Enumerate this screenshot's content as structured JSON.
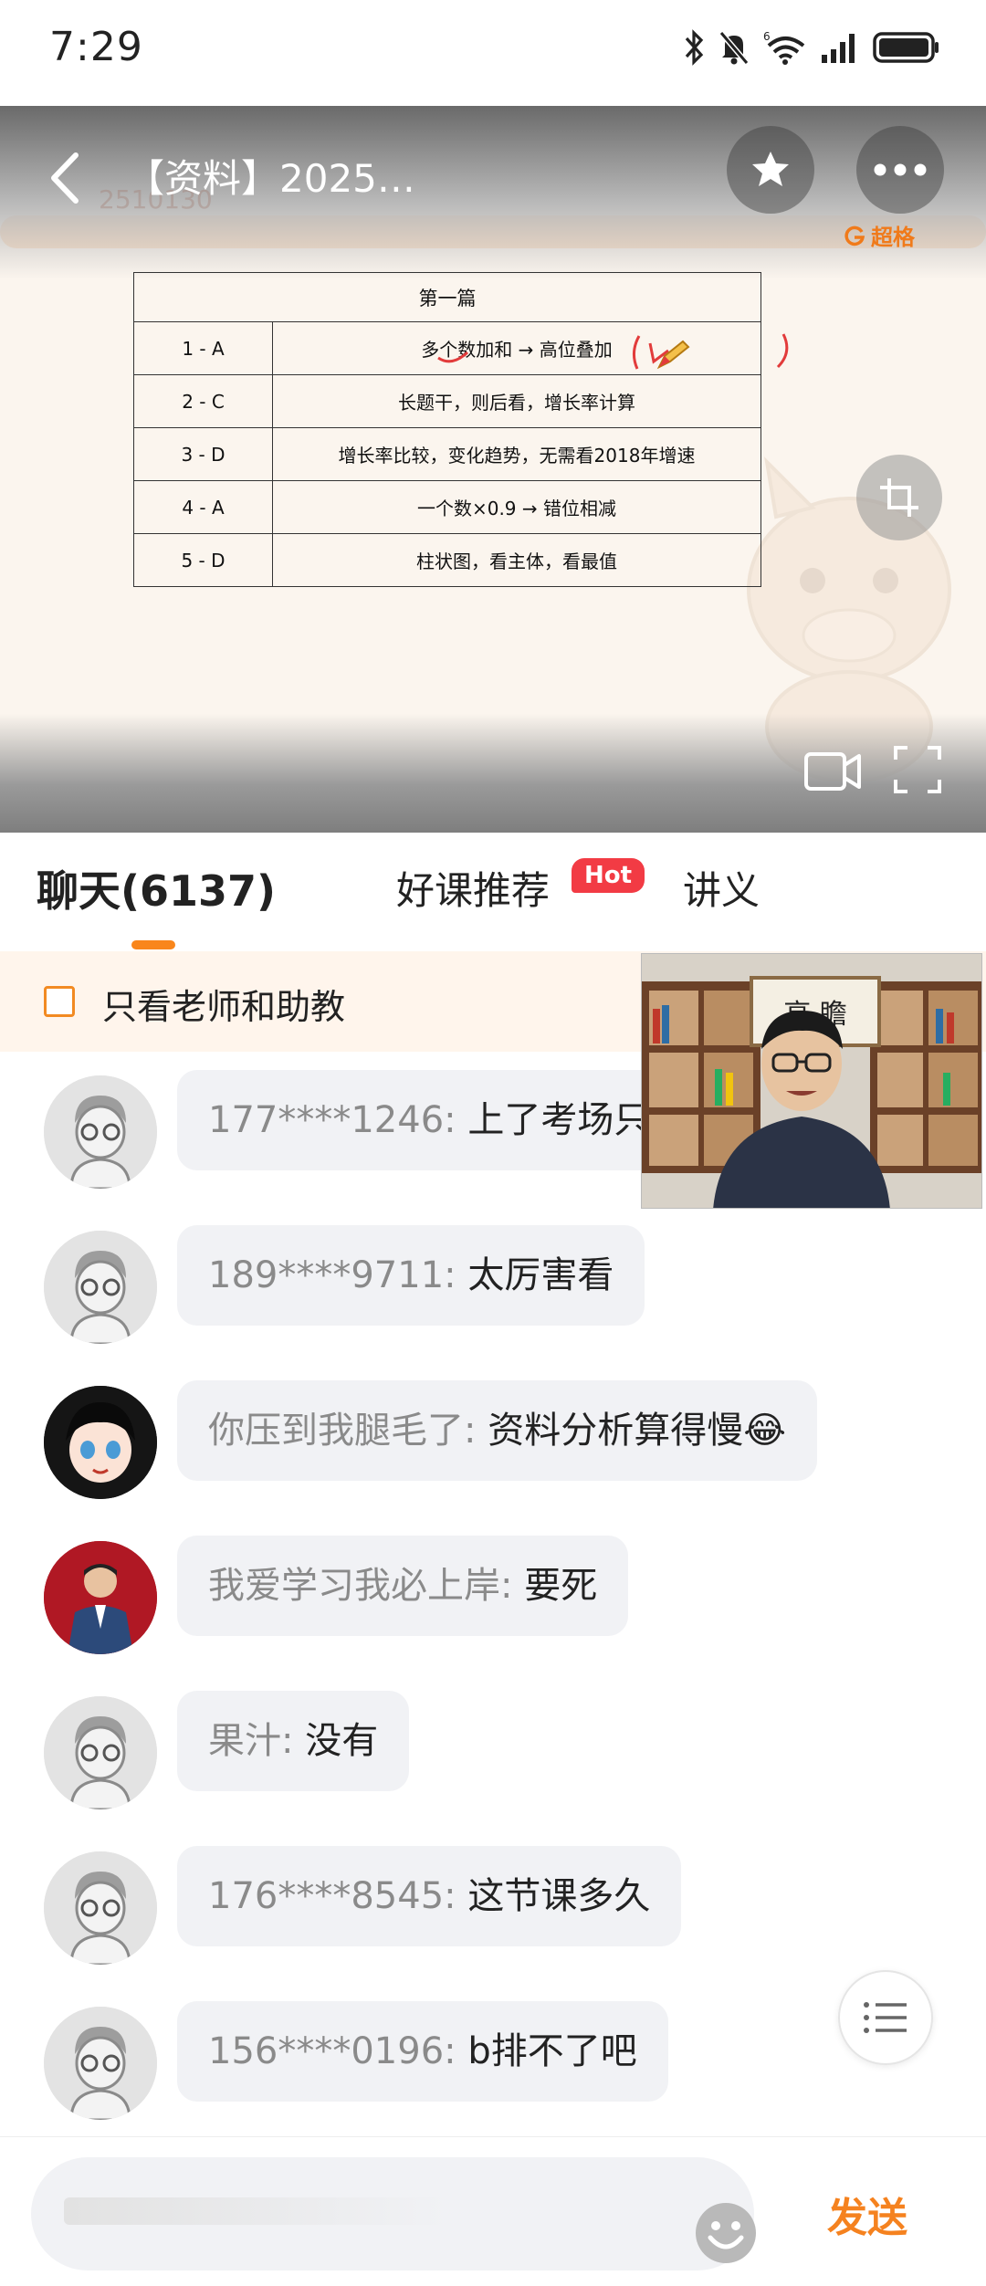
{
  "status_bar": {
    "time": "7:29",
    "icons": [
      "bluetooth-icon",
      "bell-muted-icon",
      "wifi-icon",
      "signal-icon",
      "battery-icon"
    ]
  },
  "video": {
    "title": "【资料】2025…",
    "watermark": "2510130",
    "brand": "超格",
    "slide": {
      "header": "第一篇",
      "rows": [
        {
          "q": "1 - A",
          "note": "多个数加和 → 高位叠加"
        },
        {
          "q": "2 - C",
          "note": "长题干，则后看，增长率计算"
        },
        {
          "q": "3 - D",
          "note": "增长率比较，变化趋势，无需看2018年增速"
        },
        {
          "q": "4 - A",
          "note": "一个数×0.9 → 错位相减"
        },
        {
          "q": "5 - D",
          "note": "柱状图，看主体，看最值"
        }
      ]
    }
  },
  "tabs": {
    "chat": "聊天(6137)",
    "recommend": "好课推荐",
    "hot": "Hot",
    "notes": "讲义"
  },
  "filter": {
    "label": "只看老师和助教"
  },
  "messages": [
    {
      "name": "177****1246:",
      "text": "上了考场只"
    },
    {
      "name": "189****9711:",
      "text": "太厉害看"
    },
    {
      "name": "你压到我腿毛了:",
      "text": "资料分析算得慢😂"
    },
    {
      "name": "我爱学习我必上岸:",
      "text": "要死"
    },
    {
      "name": "果汁:",
      "text": "没有"
    },
    {
      "name": "176****8545:",
      "text": "这节课多久"
    },
    {
      "name": "156****0196:",
      "text": "b排不了吧"
    }
  ],
  "pip": {
    "calligraphy": "高 瞻"
  },
  "input": {
    "send": "发送"
  },
  "colors": {
    "accent": "#f5821f",
    "hot": "#f23b44",
    "bubble": "#f1f2f5"
  }
}
